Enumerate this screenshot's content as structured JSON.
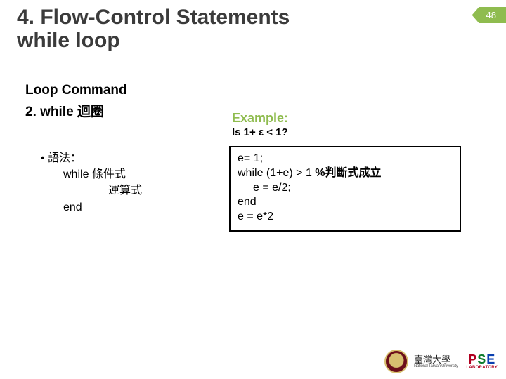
{
  "page_number": "48",
  "title_line1": "4. Flow-Control Statements",
  "title_line2": "while loop",
  "subhead1": "Loop Command",
  "subhead2": "2.  while 迴圈",
  "syntax": {
    "bullet": "• 語法：",
    "while": "while 條件式",
    "op": "運算式",
    "end": "end"
  },
  "example": {
    "label": "Example:",
    "sub": "Is 1+ ε < 1?",
    "code": {
      "l1": "e= 1;",
      "l2a": "while (1+e) > 1 ",
      "l2b": "%判斷式成立",
      "l3": "e = e/2;",
      "l4": "end",
      "l5": "e = e*2"
    }
  },
  "footer": {
    "uni_cn": "臺灣大學",
    "uni_en": "National Taiwan University",
    "pse": {
      "p": "P",
      "s": "S",
      "e": "E",
      "lab": "LABORATORY"
    }
  }
}
